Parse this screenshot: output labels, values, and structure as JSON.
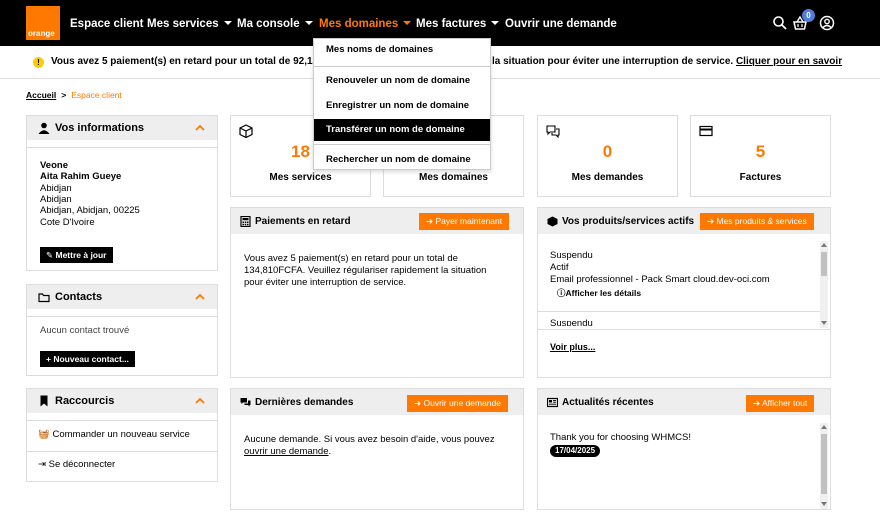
{
  "brand": {
    "logo_text": "orange",
    "accent": "#ff7900"
  },
  "nav": {
    "espace_client": "Espace client",
    "mes_services": "Mes services",
    "ma_console": "Ma console",
    "mes_domaines": "Mes domaines",
    "mes_factures": "Mes factures",
    "ouvrir_demande": "Ouvrir une demande",
    "cart_count": "0"
  },
  "alert": {
    "text_left": "Vous avez 5 paiement(s) en retard pour un total de 92,13",
    "text_right": "la situation pour éviter une interruption de service.",
    "link": "Cliquer pour en savoir"
  },
  "breadcrumb": {
    "home": "Accueil",
    "current": "Espace client"
  },
  "domains_menu": {
    "items": [
      "Mes noms de domaines",
      "Renouveler un nom de domaine",
      "Enregistrer un nom de domaine",
      "Transférer un nom de domaine",
      "Rechercher un nom de domaine"
    ]
  },
  "info_panel": {
    "title": "Vos informations",
    "company": "Veone",
    "name": "Aita Rahim Gueye",
    "line1": "Abidjan",
    "line2": "Abidjan",
    "line3": "Abidjan, Abidjan, 00225",
    "country": "Cote D'Ivoire",
    "update_button": "Mettre à jour"
  },
  "contacts_panel": {
    "title": "Contacts",
    "empty": "Aucun contact trouvé",
    "new_button": "Nouveau contact..."
  },
  "shortcuts_panel": {
    "title": "Raccourcis",
    "order": "Commander un nouveau service",
    "logout": "Se déconnecter"
  },
  "tiles": [
    {
      "number": "18",
      "label": "Mes services"
    },
    {
      "number": "",
      "label": "Mes domaines"
    },
    {
      "number": "0",
      "label": "Mes demandes"
    },
    {
      "number": "5",
      "label": "Factures"
    }
  ],
  "payments_card": {
    "title": "Paiements en retard",
    "button": "Payer maintenant",
    "body_1": "Vous avez 5 paiement(s) en retard pour un total de",
    "body_2": "134,810FCFA. Veuillez régulariser rapidement la situation",
    "body_3": "pour éviter une interruption de service."
  },
  "products_card": {
    "title": "Vos produits/services actifs",
    "button": "Mes produits & services",
    "status_1": "Suspendu",
    "status_2": "Actif",
    "email_pro": "Email professionnel - Pack Smart cloud.dev-oci.com",
    "details": "Afficher les détails",
    "next_item": "Suspendu",
    "see_more": "Voir plus..."
  },
  "requests_card": {
    "title": "Dernières demandes",
    "button": "Ouvrir une demande",
    "body_1": "Aucune demande. Si vous avez besoin d'aide, vous pouvez",
    "body_link": "ouvrir une demande",
    "body_end": "."
  },
  "news_card": {
    "title": "Actualités récentes",
    "button": "Afficher tout",
    "item": "Thank you for choosing WHMCS!",
    "date": "17/04/2025"
  }
}
